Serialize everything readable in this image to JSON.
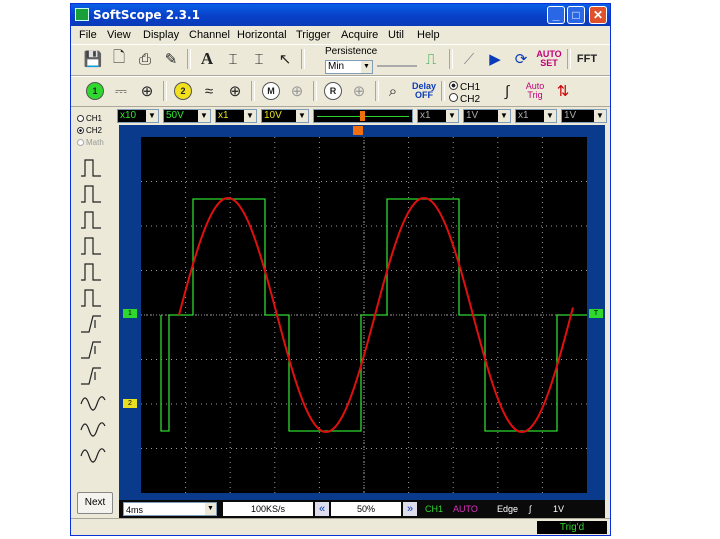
{
  "window": {
    "title": "SoftScope 2.3.1",
    "min": "_",
    "max": "□",
    "close": "✕"
  },
  "menu": [
    "File",
    "View",
    "Display",
    "Channel",
    "Horizontal",
    "Trigger",
    "Acquire",
    "Util",
    "Help"
  ],
  "toolbar1": {
    "persistence_label": "Persistence",
    "persistence_value": "Min",
    "autoset_label": "AUTO SET",
    "fft_label": "FFT"
  },
  "toolbar2": {
    "ch1_badge": "1",
    "ch2_badge": "2",
    "m_badge": "M",
    "r_badge": "R",
    "delay_label": "Delay",
    "delay_value": "OFF",
    "ch1_radio": "CH1",
    "ch2_radio": "CH2",
    "auto_trig_label": "Auto Trig"
  },
  "controls": {
    "probe1": "x10",
    "volts1": "50V",
    "probe2": "x1",
    "volts2": "10V",
    "probe3": "x1",
    "volts3": "1V",
    "probe4": "x1",
    "volts4": "1V"
  },
  "left_panel": {
    "ch1": "CH1",
    "ch2": "CH2",
    "math": "Math",
    "next": "Next",
    "trigger_icons": [
      "pulse-pos-icon",
      "pulse-neg-icon",
      "pulse-width-icon",
      "pulse-both-icon",
      "pulse-pos2-icon",
      "pulse-neg2-icon",
      "edge-rise-icon",
      "edge-fall-icon",
      "edge-both-icon",
      "video-icon",
      "video-inv-icon",
      "video-both-icon"
    ]
  },
  "markers": {
    "ch1": "1",
    "ch2": "2",
    "trigger": "T"
  },
  "bottom": {
    "timebase": "4ms",
    "samplerate": "100KS/s",
    "position": "50%",
    "trig_source": "CH1",
    "trig_mode": "AUTO",
    "trig_type": "Edge",
    "trig_level": "1V"
  },
  "status": {
    "state": "Trig'd"
  },
  "colors": {
    "square_wave": "#2ed82e",
    "sine_wave": "#e01010",
    "grid": "#9a9a9a"
  }
}
